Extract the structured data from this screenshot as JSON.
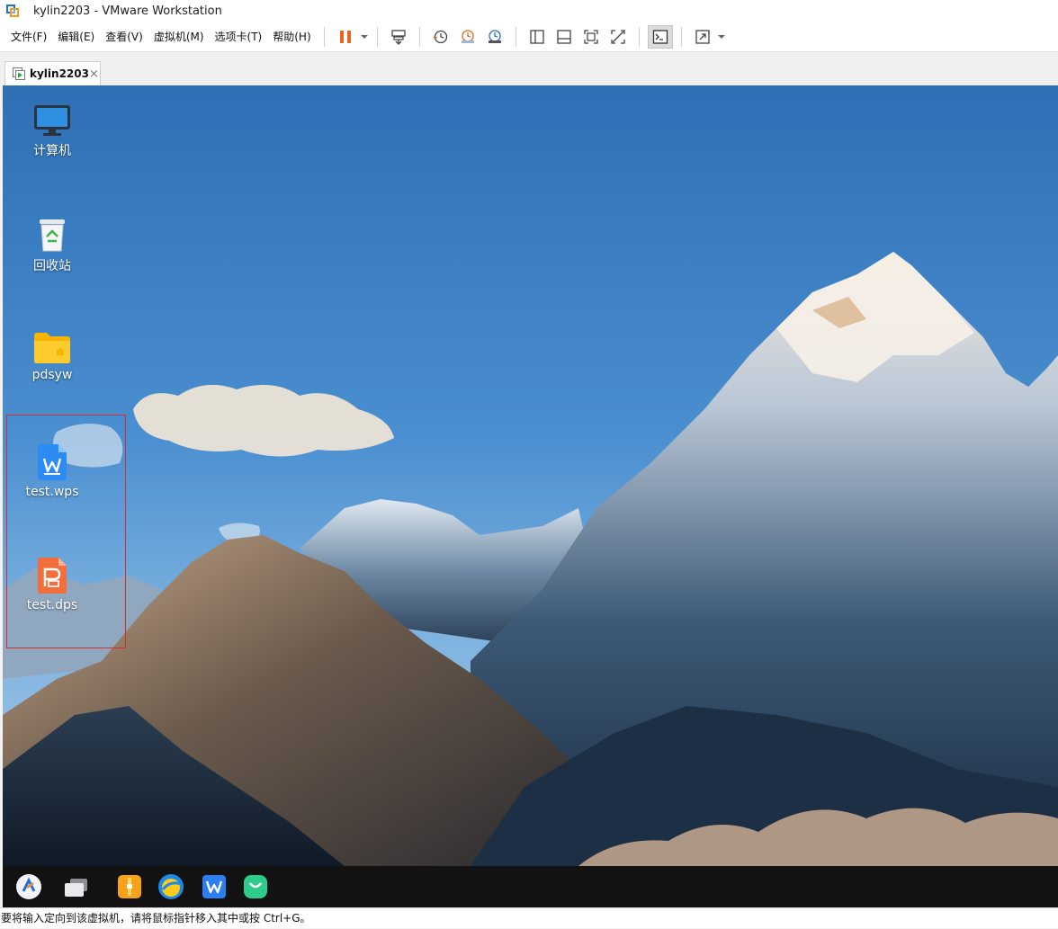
{
  "window": {
    "title": "kylin2203 - VMware Workstation"
  },
  "menu": [
    "文件(F)",
    "编辑(E)",
    "查看(V)",
    "虚拟机(M)",
    "选项卡(T)",
    "帮助(H)"
  ],
  "toolbar_icons": [
    "pause-icon",
    "dropdown-arrow-icon",
    "send-ctrl-alt-del-icon",
    "snapshot-icon",
    "revert-snapshot-icon",
    "snapshot-manager-icon",
    "show-library-icon",
    "thumbnail-bar-icon",
    "fullscreen-icon",
    "unity-icon",
    "console-view-icon",
    "stretch-guest-icon",
    "dropdown-arrow-icon"
  ],
  "tab": {
    "label": "kylin2203",
    "close": "×"
  },
  "desktop": {
    "icons": [
      {
        "label": "计算机",
        "icon": "computer-icon"
      },
      {
        "label": "回收站",
        "icon": "recycle-bin-icon"
      },
      {
        "label": "pdsyw",
        "icon": "home-folder-icon"
      },
      {
        "label": "test.wps",
        "icon": "wps-writer-file-icon"
      },
      {
        "label": "test.dps",
        "icon": "wps-presentation-file-icon"
      }
    ]
  },
  "taskbar": {
    "apps": [
      "start-menu-icon",
      "multitask-view-icon",
      "file-manager-icon",
      "browser-icon",
      "wps-office-icon",
      "software-store-icon"
    ]
  },
  "status": {
    "text": "要将输入定向到该虚拟机，请将鼠标指针移入其中或按 Ctrl+G。"
  },
  "colors": {
    "highlight": "#d32f2f",
    "pause": "#e8661b",
    "sky_top": "#2f6fb5",
    "taskbar": "#121212"
  }
}
